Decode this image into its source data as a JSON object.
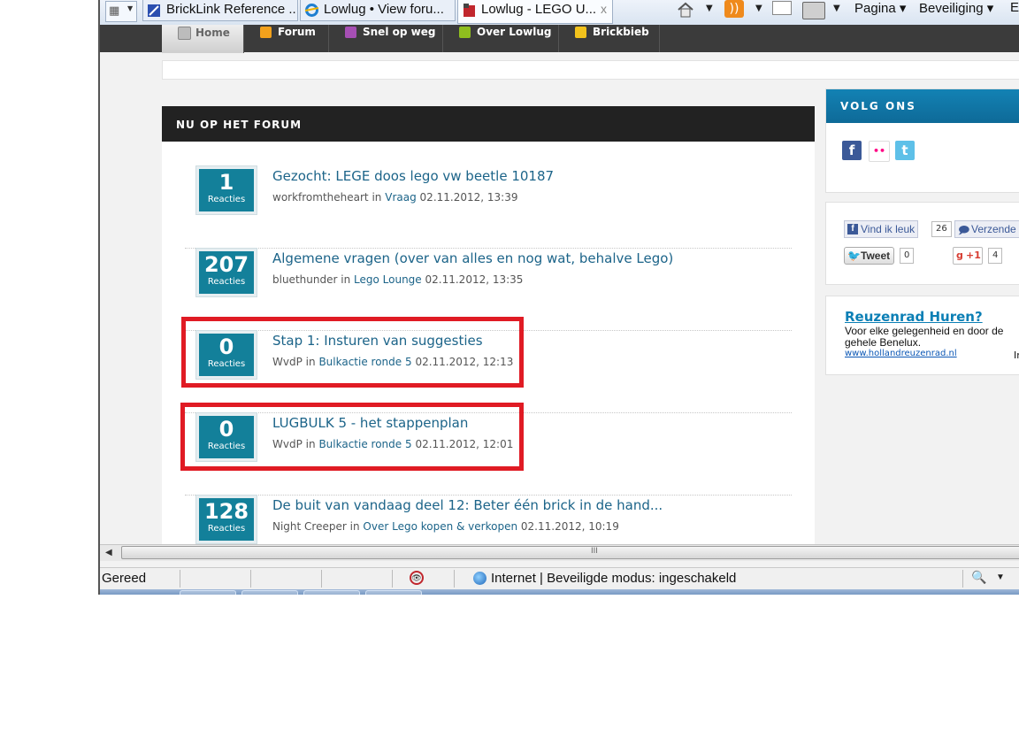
{
  "browser": {
    "tabs": [
      {
        "label": "BrickLink Reference ..."
      },
      {
        "label": "Lowlug • View foru..."
      },
      {
        "label": "Lowlug - LEGO U..."
      }
    ],
    "tab_close": "x",
    "commands": {
      "page": "Pagina",
      "security": "Beveiliging",
      "extra": "Ex"
    },
    "scroll_grip": "III"
  },
  "site_nav": {
    "items": [
      {
        "label": "Home",
        "icon": "home-icon"
      },
      {
        "label": "Forum",
        "icon": "forum-icon"
      },
      {
        "label": "Snel op weg",
        "icon": "quickstart-icon"
      },
      {
        "label": "Over Lowlug",
        "icon": "info-icon"
      },
      {
        "label": "Brickbieb",
        "icon": "library-icon"
      }
    ]
  },
  "forum": {
    "heading": "NU OP HET FORUM",
    "reply_label": "Reacties",
    "posts": [
      {
        "count": "1",
        "title": "Gezocht: LEGE doos lego vw beetle 10187",
        "author": "workfromtheheart",
        "in": "in",
        "category": "Vraag",
        "date": "02.11.2012, 13:39"
      },
      {
        "count": "207",
        "title": "Algemene vragen (over van alles en nog wat, behalve Lego)",
        "author": "bluethunder",
        "in": "in",
        "category": "Lego Lounge",
        "date": "02.11.2012, 13:35"
      },
      {
        "count": "0",
        "title": "Stap 1: Insturen van suggesties",
        "author": "WvdP",
        "in": "in",
        "category": "Bulkactie ronde 5",
        "date": "02.11.2012, 12:13"
      },
      {
        "count": "0",
        "title": "LUGBULK 5 - het stappenplan",
        "author": "WvdP",
        "in": "in",
        "category": "Bulkactie ronde 5",
        "date": "02.11.2012, 12:01"
      },
      {
        "count": "128",
        "title": "De buit van vandaag deel 12: Beter één brick in de hand...",
        "author": "Night Creeper",
        "in": "in",
        "category": "Over Lego kopen & verkopen",
        "date": "02.11.2012, 10:19"
      }
    ]
  },
  "sidebar": {
    "follow_heading": "VOLG ONS",
    "social": {
      "facebook": "f",
      "flickr": "••",
      "twitter": "t"
    },
    "like_label": "Vind ik leuk",
    "like_count": "26",
    "send_label": "Verzende",
    "tweet_label": "Tweet",
    "tweet_count": "0",
    "gplus_label": "+1",
    "gplus_count": "4",
    "ad_title": "Reuzenrad Huren?",
    "ad_text": "Voor elke gelegenheid en door de gehele Benelux.",
    "ad_link": "www.hollandreuzenrad.nl",
    "ad_trailing": "In"
  },
  "statusbar": {
    "ready": "Gereed",
    "zone": "Internet | Beveiligde modus: ingeschakeld"
  },
  "colors": {
    "badge": "#13809a",
    "link": "#1c6489",
    "highlight": "#e01b24",
    "header": "#222222",
    "sidebar_header": "#1382b4"
  }
}
